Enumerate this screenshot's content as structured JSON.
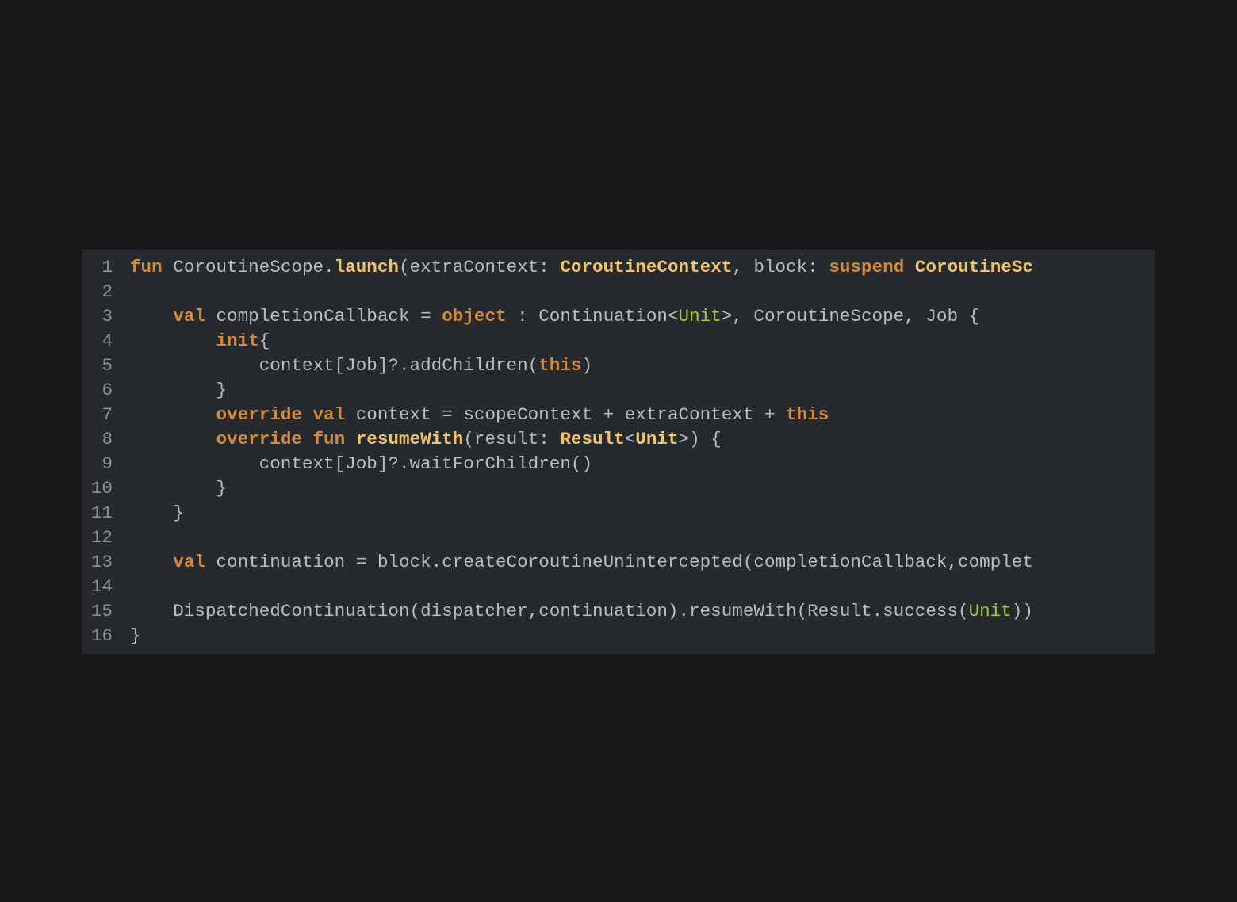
{
  "colors": {
    "background": "#181818",
    "panel": "#262a2e",
    "keyword": "#d58a3a",
    "function": "#f2c36b",
    "type": "#f2c36b",
    "generic": "#9acd32",
    "text": "#b8bdc4",
    "line_number": "#8a9097"
  },
  "code_lines": [
    {
      "number": "1",
      "tokens": [
        {
          "kind": "kw",
          "text": "fun"
        },
        {
          "kind": "plain",
          "text": " CoroutineScope."
        },
        {
          "kind": "fn",
          "text": "launch"
        },
        {
          "kind": "plain",
          "text": "(extraContext: "
        },
        {
          "kind": "type",
          "text": "CoroutineContext"
        },
        {
          "kind": "plain",
          "text": ", block: "
        },
        {
          "kind": "kw",
          "text": "suspend"
        },
        {
          "kind": "plain",
          "text": " "
        },
        {
          "kind": "type",
          "text": "CoroutineSc"
        }
      ]
    },
    {
      "number": "2",
      "tokens": []
    },
    {
      "number": "3",
      "tokens": [
        {
          "kind": "plain",
          "text": "    "
        },
        {
          "kind": "kw",
          "text": "val"
        },
        {
          "kind": "plain",
          "text": " completionCallback = "
        },
        {
          "kind": "kw",
          "text": "object"
        },
        {
          "kind": "plain",
          "text": " : Continuation<"
        },
        {
          "kind": "gen",
          "text": "Unit"
        },
        {
          "kind": "plain",
          "text": ">, CoroutineScope, Job {"
        }
      ]
    },
    {
      "number": "4",
      "tokens": [
        {
          "kind": "plain",
          "text": "        "
        },
        {
          "kind": "kw",
          "text": "init"
        },
        {
          "kind": "plain",
          "text": "{"
        }
      ]
    },
    {
      "number": "5",
      "tokens": [
        {
          "kind": "plain",
          "text": "            context[Job]?.addChildren("
        },
        {
          "kind": "kw",
          "text": "this"
        },
        {
          "kind": "plain",
          "text": ")"
        }
      ]
    },
    {
      "number": "6",
      "tokens": [
        {
          "kind": "plain",
          "text": "        }"
        }
      ]
    },
    {
      "number": "7",
      "tokens": [
        {
          "kind": "plain",
          "text": "        "
        },
        {
          "kind": "kw",
          "text": "override"
        },
        {
          "kind": "plain",
          "text": " "
        },
        {
          "kind": "kw",
          "text": "val"
        },
        {
          "kind": "plain",
          "text": " context = scopeContext + extraContext + "
        },
        {
          "kind": "kw",
          "text": "this"
        }
      ]
    },
    {
      "number": "8",
      "tokens": [
        {
          "kind": "plain",
          "text": "        "
        },
        {
          "kind": "kw",
          "text": "override"
        },
        {
          "kind": "plain",
          "text": " "
        },
        {
          "kind": "kw",
          "text": "fun"
        },
        {
          "kind": "plain",
          "text": " "
        },
        {
          "kind": "fn",
          "text": "resumeWith"
        },
        {
          "kind": "plain",
          "text": "(result: "
        },
        {
          "kind": "type",
          "text": "Result"
        },
        {
          "kind": "plain",
          "text": "<"
        },
        {
          "kind": "type",
          "text": "Unit"
        },
        {
          "kind": "plain",
          "text": ">) {"
        }
      ]
    },
    {
      "number": "9",
      "tokens": [
        {
          "kind": "plain",
          "text": "            context[Job]?.waitForChildren()"
        }
      ]
    },
    {
      "number": "10",
      "tokens": [
        {
          "kind": "plain",
          "text": "        }"
        }
      ]
    },
    {
      "number": "11",
      "tokens": [
        {
          "kind": "plain",
          "text": "    }"
        }
      ]
    },
    {
      "number": "12",
      "tokens": []
    },
    {
      "number": "13",
      "tokens": [
        {
          "kind": "plain",
          "text": "    "
        },
        {
          "kind": "kw",
          "text": "val"
        },
        {
          "kind": "plain",
          "text": " continuation = block.createCoroutineUnintercepted(completionCallback,complet"
        }
      ]
    },
    {
      "number": "14",
      "tokens": []
    },
    {
      "number": "15",
      "tokens": [
        {
          "kind": "plain",
          "text": "    DispatchedContinuation(dispatcher,continuation).resumeWith(Result.success("
        },
        {
          "kind": "gen",
          "text": "Unit"
        },
        {
          "kind": "plain",
          "text": "))"
        }
      ]
    },
    {
      "number": "16",
      "tokens": [
        {
          "kind": "plain",
          "text": "}"
        }
      ]
    }
  ]
}
